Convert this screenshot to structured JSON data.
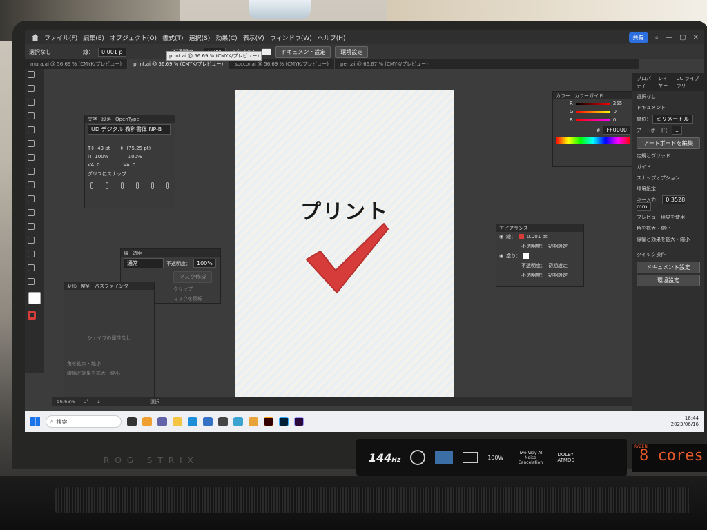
{
  "app": {
    "menu": [
      "ファイル(F)",
      "編集(E)",
      "オブジェクト(O)",
      "書式(T)",
      "選択(S)",
      "効果(C)",
      "表示(V)",
      "ウィンドウ(W)",
      "ヘルプ(H)"
    ],
    "share_label": "共有",
    "selection_status": "選択なし"
  },
  "control_bar": {
    "stroke_label": "線：",
    "stroke_value": "0.001 p",
    "opacity_label": "不透明度：",
    "opacity_value": "100%",
    "style_label": "スタイル：",
    "doc_settings": "ドキュメント設定",
    "prefs": "環境設定"
  },
  "tooltip": "print.ai @ 56.69 % (CMYK/プレビュー)",
  "tabs": [
    {
      "label": "mura.ai @ 56.69 % (CMYK/プレビュー)",
      "active": false
    },
    {
      "label": "print.ai @ 56.69 % (CMYK/プレビュー)",
      "active": true
    },
    {
      "label": "soccor.ai @ 56.69 % (CMYK/プレビュー)",
      "active": false
    },
    {
      "label": "pen.ai @ 66.67 % (CMYK/プレビュー)",
      "active": false
    }
  ],
  "artboard": {
    "title": "プリント",
    "check_color": "#d63c3a"
  },
  "character_panel": {
    "tabs": [
      "文字",
      "段落",
      "OpenType"
    ],
    "font": "UD デジタル 教科書体 NP-B",
    "size": "43 pt",
    "leading": "(75.25 pt)",
    "hscale": "100%",
    "vscale": "100%",
    "tracking": "0",
    "kerning": "0",
    "snap_label": "グリフにスナップ"
  },
  "transparency_panel": {
    "tabs": [
      "線",
      "透明"
    ],
    "blend": "通常",
    "opacity_label": "不透明度：",
    "opacity_value": "100%",
    "make_mask": "マスク作成",
    "clip": "クリップ",
    "invert": "マスクを反転"
  },
  "transform_panel": {
    "tabs": [
      "変形",
      "整列",
      "パスファインダー"
    ],
    "no_shape": "シェイプの属性なし",
    "opt1": "角を拡大・縮小",
    "opt2": "線幅と効果を拡大・縮小"
  },
  "color_panel": {
    "tabs": [
      "カラー",
      "カラーガイド"
    ],
    "r": "255",
    "g": "0",
    "b": "0",
    "hex": "FF0000"
  },
  "appearance_panel": {
    "title": "アピアランス",
    "stroke_label": "線：",
    "stroke_value": "0.001 pt",
    "opacity": "不透明度：",
    "default": "初期設定",
    "fill_label": "塗り："
  },
  "dock": {
    "tabs": [
      "プロパティ",
      "レイヤー",
      "CC ライブラリ"
    ],
    "no_selection": "選択なし",
    "document": "ドキュメント",
    "unit_label": "単位：",
    "unit_value": "ミリメートル",
    "artboard_label": "アートボード：",
    "artboard_value": "1",
    "artboard_btn": "アートボードを編集",
    "rulers": "定規とグリッド",
    "guides": "ガイド",
    "snap": "スナップオプション",
    "prefs_title": "環境設定",
    "key_label": "キー入力：",
    "key_value": "0.3528 mm",
    "check1": "プレビュー境界を使用",
    "check2": "角を拡大・縮小",
    "check3": "線幅と効果を拡大・縮小",
    "quick": "クイック操作",
    "doc_btn": "ドキュメント設定",
    "pref_btn": "環境設定"
  },
  "status": {
    "zoom": "56.69%",
    "angle": "0°",
    "page": "1",
    "mode": "選択"
  },
  "taskbar": {
    "search": "検索",
    "time": "16:44",
    "date": "2023/06/16"
  },
  "laptop": {
    "hz": "144",
    "hz_unit": "Hz",
    "watt": "100W",
    "noise": "Two-Way AI Noise Cancelation",
    "dolby": "DOLBY ATMOS",
    "cores": "8 cores",
    "ryzen": "RYZEN",
    "brand": "ROG STRIX"
  }
}
